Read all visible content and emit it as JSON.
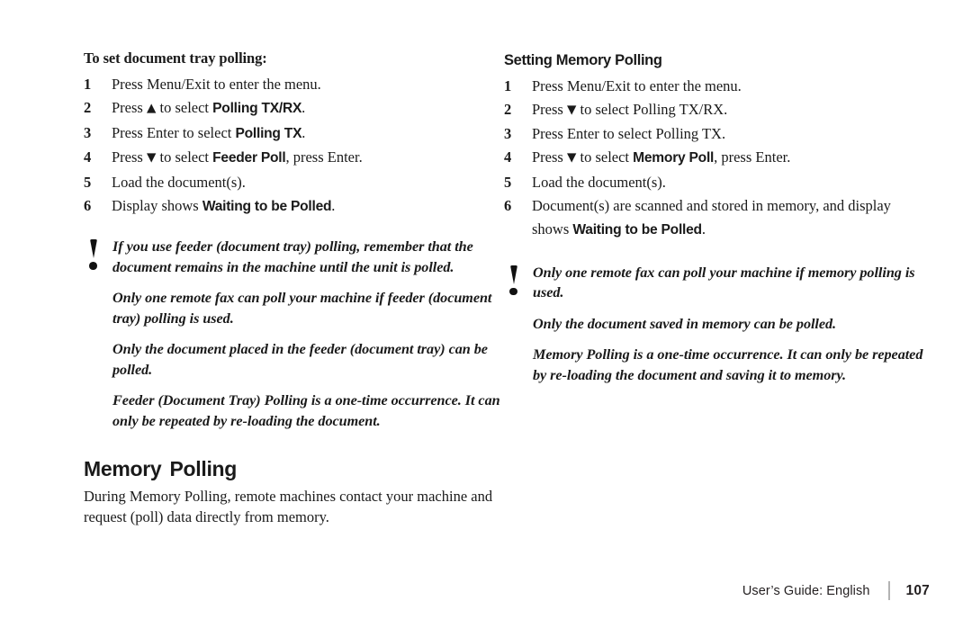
{
  "page": {
    "background": "#ffffff",
    "text_color": "#1a1a1a"
  },
  "left_column": {
    "heading": "To set document tray polling:",
    "steps": [
      {
        "num": "1",
        "parts": [
          {
            "text": "Press ",
            "style": "plain"
          },
          {
            "text": "Menu/Exit",
            "style": "bold"
          },
          {
            "text": " to enter the menu.",
            "style": "plain"
          }
        ]
      },
      {
        "num": "2",
        "parts": [
          {
            "text": "Press ",
            "style": "plain"
          },
          {
            "text": "▲",
            "style": "arrow"
          },
          {
            "text": " to select ",
            "style": "plain"
          },
          {
            "text": "Polling TX/RX",
            "style": "lcd"
          },
          {
            "text": ".",
            "style": "plain"
          }
        ]
      },
      {
        "num": "3",
        "parts": [
          {
            "text": "Press ",
            "style": "plain"
          },
          {
            "text": "Enter",
            "style": "bold"
          },
          {
            "text": " to select ",
            "style": "plain"
          },
          {
            "text": "Polling TX",
            "style": "lcd"
          },
          {
            "text": ".",
            "style": "plain"
          }
        ]
      },
      {
        "num": "4",
        "parts": [
          {
            "text": "Press ",
            "style": "plain"
          },
          {
            "text": "▼",
            "style": "arrow"
          },
          {
            "text": " to select ",
            "style": "plain"
          },
          {
            "text": "Feeder Poll",
            "style": "lcd"
          },
          {
            "text": ", press ",
            "style": "plain"
          },
          {
            "text": "Enter",
            "style": "bold"
          },
          {
            "text": ".",
            "style": "plain"
          }
        ]
      },
      {
        "num": "5",
        "parts": [
          {
            "text": "Load the document(s).",
            "style": "plain"
          }
        ]
      },
      {
        "num": "6",
        "parts": [
          {
            "text": "Display shows ",
            "style": "plain"
          },
          {
            "text": "Waiting to be Polled",
            "style": "lcd"
          },
          {
            "text": ".",
            "style": "plain"
          }
        ]
      }
    ],
    "note": {
      "icon": "exclamation-warning-icon",
      "paragraphs": [
        "If you use feeder (document tray) polling, remember that the document remains in the machine until the unit is polled.",
        "Only one remote fax can poll your machine if feeder (document tray) polling is used.",
        "Only the document placed in the feeder (document tray) can be polled.",
        "Feeder (Document Tray) Polling is a one-time occurrence.  It can only be repeated by re-loading the document."
      ]
    },
    "section_title": "Memory  Polling",
    "section_body": "During Memory Polling, remote machines contact your machine and request (poll) data directly from memory."
  },
  "right_column": {
    "heading": "Setting Memory Polling",
    "steps": [
      {
        "num": "1",
        "parts": [
          {
            "text": "Press ",
            "style": "plain"
          },
          {
            "text": "Menu/Exit",
            "style": "bold"
          },
          {
            "text": " to enter the menu.",
            "style": "plain"
          }
        ]
      },
      {
        "num": "2",
        "parts": [
          {
            "text": "Press ",
            "style": "plain"
          },
          {
            "text": "▼",
            "style": "arrow"
          },
          {
            "text": " to select Polling TX/RX.",
            "style": "plain"
          }
        ]
      },
      {
        "num": "3",
        "parts": [
          {
            "text": "Press ",
            "style": "plain"
          },
          {
            "text": "Enter",
            "style": "bold"
          },
          {
            "text": " to select Polling TX.",
            "style": "plain"
          }
        ]
      },
      {
        "num": "4",
        "parts": [
          {
            "text": "Press ",
            "style": "plain"
          },
          {
            "text": "▼",
            "style": "arrow"
          },
          {
            "text": " to select ",
            "style": "plain"
          },
          {
            "text": "Memory Poll",
            "style": "lcd"
          },
          {
            "text": ", press ",
            "style": "plain"
          },
          {
            "text": "Enter",
            "style": "bold"
          },
          {
            "text": ".",
            "style": "plain"
          }
        ]
      },
      {
        "num": "5",
        "parts": [
          {
            "text": "Load the document(s).",
            "style": "plain"
          }
        ]
      },
      {
        "num": "6",
        "parts": [
          {
            "text": "Document(s) are scanned and stored in memory, and display shows ",
            "style": "plain"
          },
          {
            "text": "Waiting to be Polled",
            "style": "lcd"
          },
          {
            "text": ".",
            "style": "plain"
          }
        ]
      }
    ],
    "note": {
      "icon": "exclamation-warning-icon",
      "paragraphs": [
        "Only one remote fax can poll your machine if memory polling is used.",
        "Only the document saved in memory can be polled.",
        "Memory Polling is a one-time occurrence.  It can only be repeated by re-loading the document and saving it to memory."
      ]
    }
  },
  "footer": {
    "guide_label": "User’s Guide:",
    "language": "English",
    "page_number": "107",
    "divider_color": "#b3b3b3"
  }
}
